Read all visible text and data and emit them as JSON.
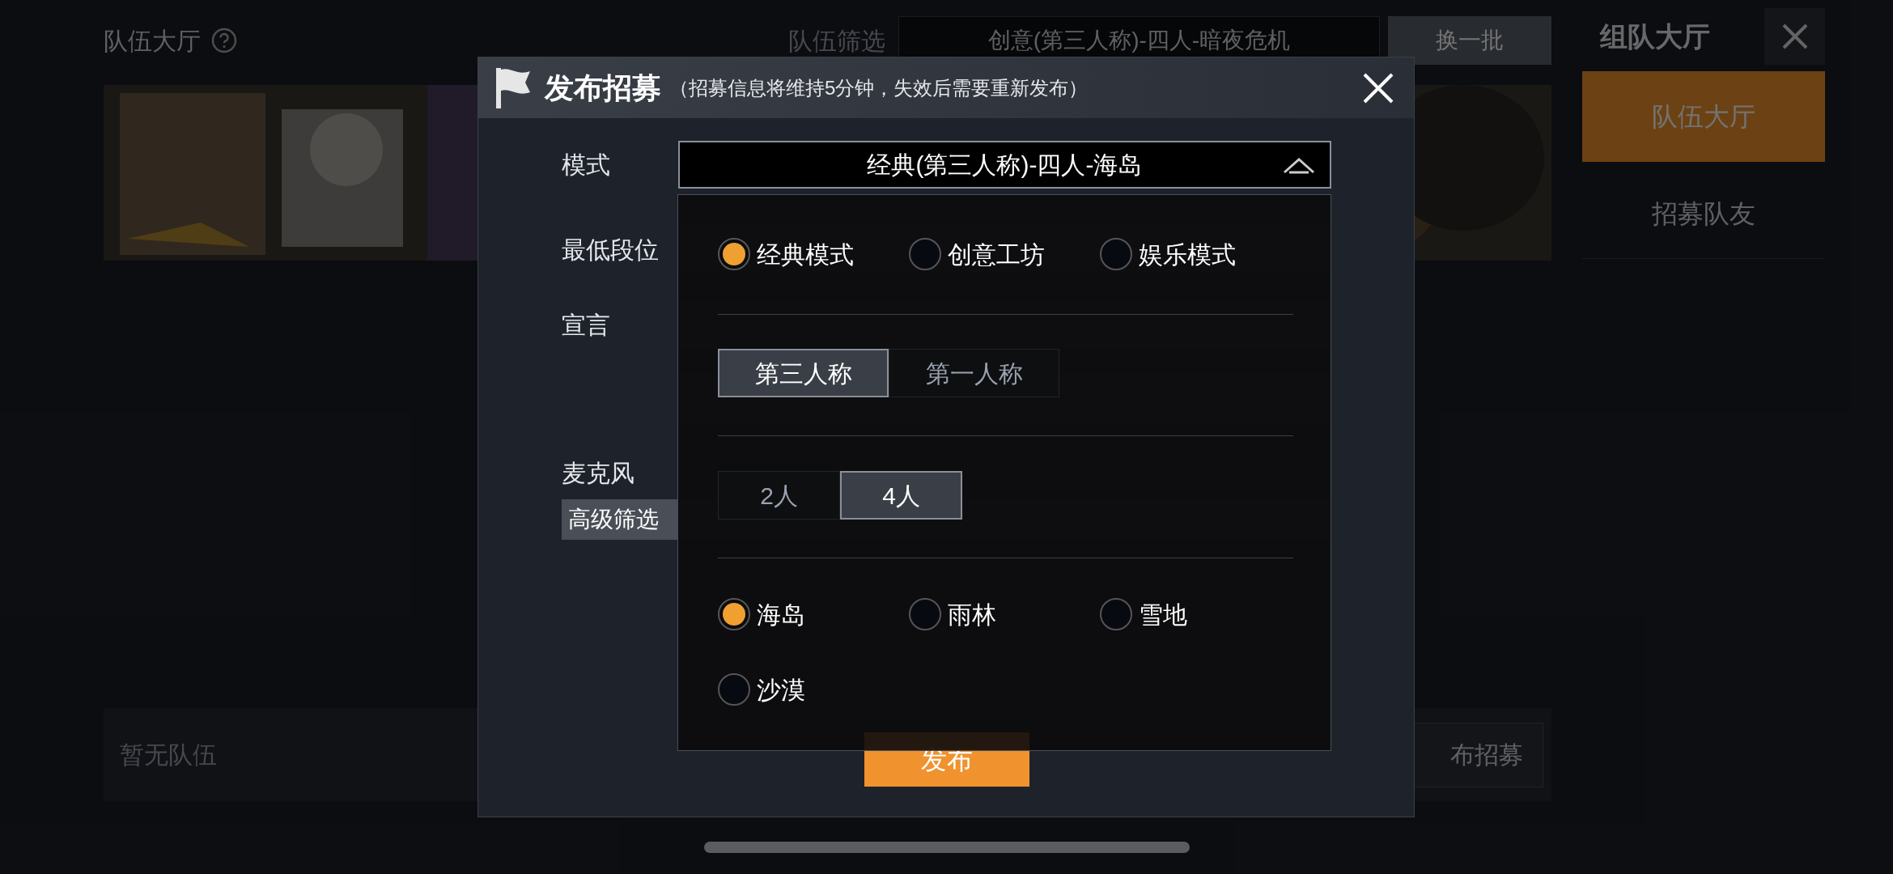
{
  "page": {
    "title": "队伍大厅",
    "filter_label": "队伍筛选",
    "filter_value": "创意(第三人称)-四人-暗夜危机",
    "refresh_button": "换一批",
    "empty_text": "暂无队伍",
    "publish_button": "布招募"
  },
  "sidebar": {
    "title": "组队大厅",
    "tabs": [
      {
        "label": "队伍大厅",
        "selected": true
      },
      {
        "label": "招募队友",
        "selected": false
      }
    ]
  },
  "dialog": {
    "title": "发布招募",
    "subtitle": "（招募信息将维持5分钟，失效后需要重新发布）",
    "mode": {
      "label": "模式",
      "value": "经典(第三人称)-四人-海岛",
      "expanded": true
    },
    "rank_label": "最低段位",
    "declaration": {
      "label": "宣言"
    },
    "mic_label": "麦克风",
    "advanced_label": "高级筛选",
    "publish_button": "发布"
  },
  "mode_panel": {
    "modes": [
      {
        "label": "经典模式",
        "selected": true
      },
      {
        "label": "创意工坊",
        "selected": false
      },
      {
        "label": "娱乐模式",
        "selected": false
      }
    ],
    "perspectives": [
      {
        "label": "第三人称",
        "selected": true
      },
      {
        "label": "第一人称",
        "selected": false
      }
    ],
    "team_sizes": [
      {
        "label": "2人",
        "selected": false
      },
      {
        "label": "4人",
        "selected": true
      }
    ],
    "maps": [
      {
        "label": "海岛",
        "selected": true
      },
      {
        "label": "雨林",
        "selected": false
      },
      {
        "label": "雪地",
        "selected": false
      },
      {
        "label": "沙漠",
        "selected": false
      }
    ]
  }
}
